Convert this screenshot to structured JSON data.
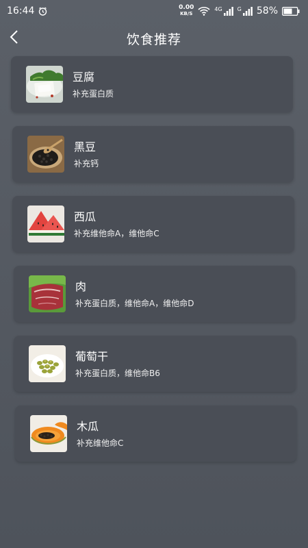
{
  "status_bar": {
    "time": "16:44",
    "net_speed_value": "0.00",
    "net_speed_unit": "KB/S",
    "signal_label_1": "4G",
    "signal_label_2": "G",
    "battery_percent": "58%"
  },
  "header": {
    "title": "饮食推荐"
  },
  "foods": [
    {
      "name": "豆腐",
      "desc": "补充蛋白质",
      "icon": "tofu-image"
    },
    {
      "name": "黑豆",
      "desc": "补充钙",
      "icon": "black-beans-image"
    },
    {
      "name": "西瓜",
      "desc": "补充维他命A，维他命C",
      "icon": "watermelon-image"
    },
    {
      "name": "肉",
      "desc": "补充蛋白质，维他命A，维他命D",
      "icon": "meat-image"
    },
    {
      "name": "葡萄干",
      "desc": "补充蛋白质，维他命B6",
      "icon": "raisins-image"
    },
    {
      "name": "木瓜",
      "desc": "补充维他命C",
      "icon": "papaya-image"
    }
  ]
}
